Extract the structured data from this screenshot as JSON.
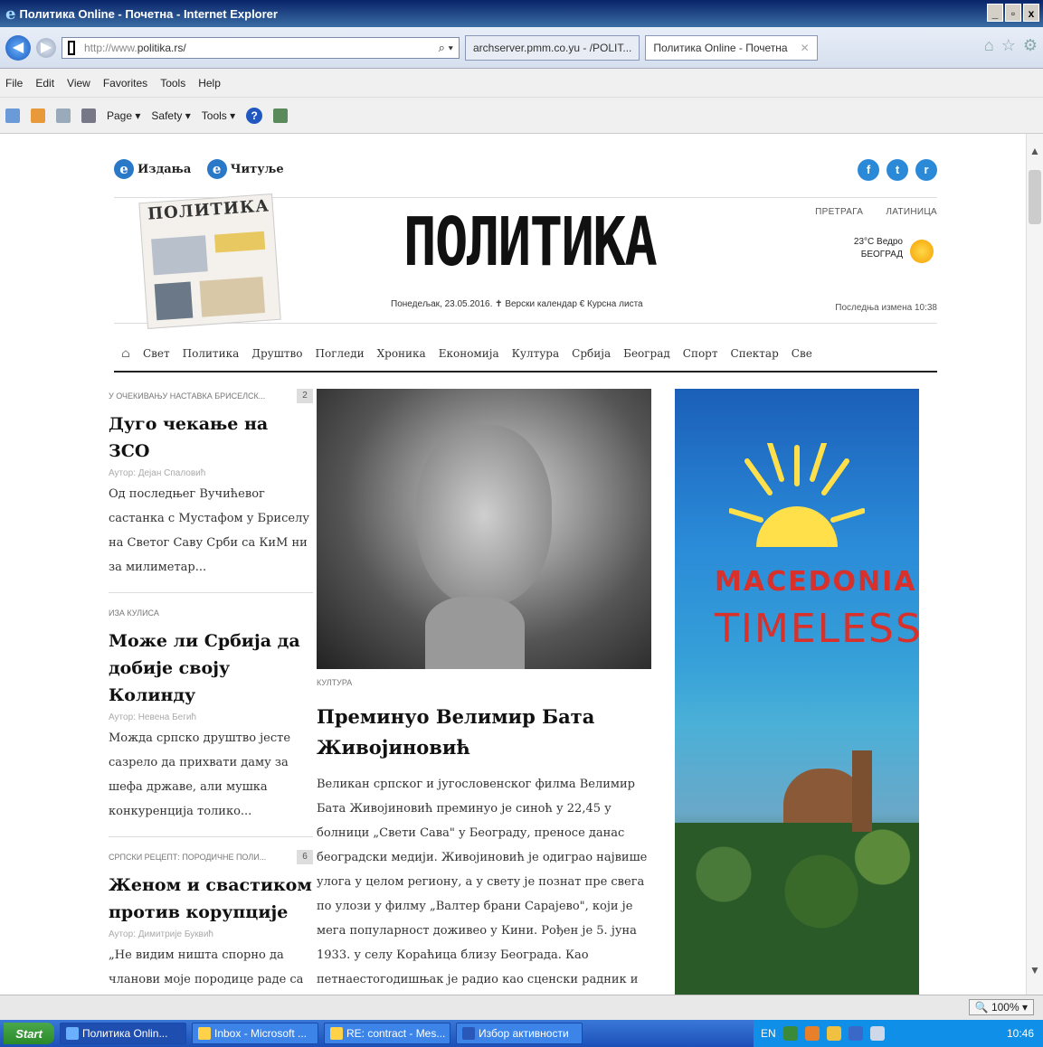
{
  "window": {
    "title": "Политика Online - Почетна - Internet Explorer",
    "controls": [
      "_",
      "▫",
      "x"
    ]
  },
  "address": {
    "url_prefix": "http://www.",
    "url_domain": "politika.rs/",
    "tab1": "archserver.pmm.co.yu - /POLIT...",
    "tab2": "Политика Online - Почетна"
  },
  "menu": [
    "File",
    "Edit",
    "View",
    "Favorites",
    "Tools",
    "Help"
  ],
  "commandbar": {
    "page": "Page ▾",
    "safety": "Safety ▾",
    "tools": "Tools ▾"
  },
  "site": {
    "editions": [
      "Издања",
      "Читуље"
    ],
    "social": [
      "f",
      "t",
      "r"
    ],
    "logo": "ПОЛИТИКА",
    "paper_thumb_title": "ПОЛИТИКА",
    "dateline": "Понедељак, 23.05.2016.   ✝ Верски календар   € Курсна листа",
    "links": [
      "ПРЕТРАГА",
      "ЛАТИНИЦА"
    ],
    "weather_line1": "23°C Ведро",
    "weather_line2": "БЕОГРАД",
    "last_change": "Последња измена 10:38",
    "nav": [
      "Свет",
      "Политика",
      "Друштво",
      "Погледи",
      "Хроника",
      "Економија",
      "Култура",
      "Србија",
      "Београд",
      "Спорт",
      "Спектар",
      "Све"
    ]
  },
  "left_articles": [
    {
      "kicker": "У ОЧЕКИВАЊУ НАСТАВКА БРИСЕЛСК...",
      "num": "2",
      "title": "Дуго чекање на ЗСО",
      "author": "Аутор: Дејан Спаловић",
      "body": "Од последњег Вучићевог састанка с Мустафом у Бриселу на Светог Саву Срби са КиМ ни за милиметар..."
    },
    {
      "kicker": "ИЗА КУЛИСА",
      "num": "",
      "title": "Може ли Србија да добије своју Колинду",
      "author": "Аутор: Невена Бегић",
      "body": "Можда српско друштво јесте сазрело да прихвати даму за шефа државе, али мушка конкуренција толико..."
    },
    {
      "kicker": "СРПСКИ РЕЦЕПТ: ПОРОДИЧНЕ ПОЛИ...",
      "num": "6",
      "title": "Женом и свастиком против корупције",
      "author": "Аутор: Димитрије Буквић",
      "body": "„Не видим ништа спорно да чланови моје породице раде са"
    }
  ],
  "main_article": {
    "kicker": "КУЛТУРА",
    "title": "Преминуо Велимир Бата Живојиновић",
    "body": "Великан српског и југословенског филма Велимир Бата Живојиновић преминуо је синоћ у 22,45 у болници „Свети Сава\" у Београду, преносе данас београдски медији. Живојиновић је одиграо највише улога у целом региону, а у свету је познат пре свега по улози у филму „Валтер брани Сарајево\", који је мега популарност доживео у Кини. Рођен је 5. јуна 1933. у селу Кораћица близу Београда. Као петнаестогодишњак је радио као сценски радник и"
  },
  "ad": {
    "line1": "MACEDONIA",
    "line2": "TIMELESS"
  },
  "statusbar": {
    "zoom": "100%"
  },
  "taskbar": {
    "start": "Start",
    "buttons": [
      "Политика Onlin...",
      "Inbox - Microsoft ...",
      "RE: contract - Mes...",
      "Избор активности"
    ],
    "lang": "EN",
    "clock": "10:46"
  }
}
